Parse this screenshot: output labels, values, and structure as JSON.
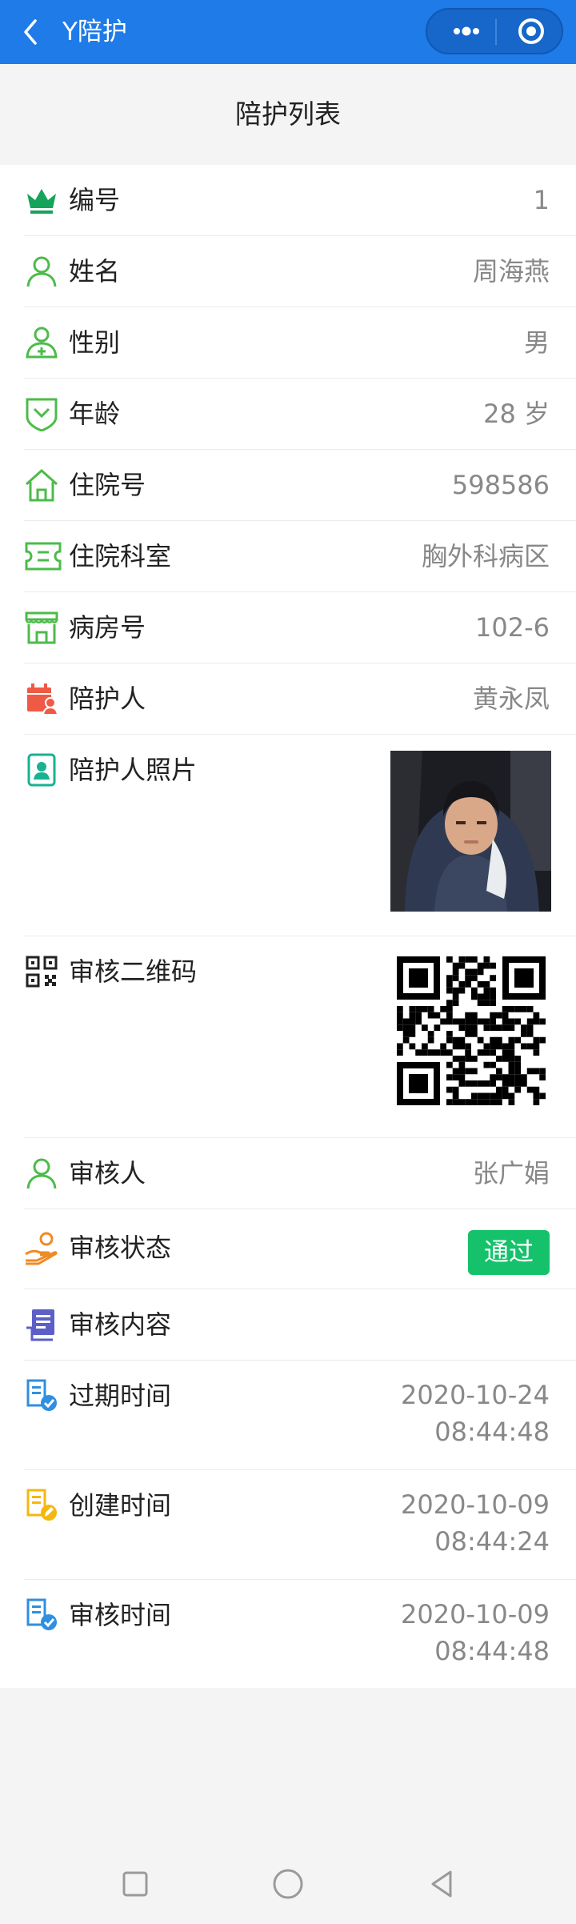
{
  "header": {
    "app_title": "Y陪护",
    "colors": {
      "bar": "#1e7be8",
      "capsule": "#1667c9"
    },
    "icons": [
      "back-arrow-icon",
      "more-dots-icon",
      "target-icon"
    ]
  },
  "page": {
    "title": "陪护列表"
  },
  "rows": {
    "number": {
      "label": "编号",
      "value": "1",
      "icon": "crown-icon"
    },
    "name": {
      "label": "姓名",
      "value": "周海燕",
      "icon": "person-icon"
    },
    "gender": {
      "label": "性别",
      "value": "男",
      "icon": "person-plus-icon"
    },
    "age": {
      "label": "年龄",
      "value": "28 岁",
      "icon": "shield-chevron-icon"
    },
    "admission_no": {
      "label": "住院号",
      "value": "598586",
      "icon": "home-icon"
    },
    "department": {
      "label": "住院科室",
      "value": "胸外科病区",
      "icon": "ticket-icon"
    },
    "room": {
      "label": "病房号",
      "value": "102-6",
      "icon": "store-icon"
    },
    "caregiver": {
      "label": "陪护人",
      "value": "黄永凤",
      "icon": "calendar-person-icon"
    },
    "caregiver_photo": {
      "label": "陪护人照片",
      "icon": "id-photo-icon"
    },
    "review_qr": {
      "label": "审核二维码",
      "icon": "qr-code-icon"
    },
    "reviewer": {
      "label": "审核人",
      "value": "张广娟",
      "icon": "person-icon"
    },
    "review_status": {
      "label": "审核状态",
      "value": "通过",
      "icon": "hand-coin-icon",
      "badge_color": "#15c26b"
    },
    "review_content": {
      "label": "审核内容",
      "icon": "document-icon"
    },
    "expire_time": {
      "label": "过期时间",
      "date": "2020-10-24",
      "time": "08:44:48",
      "icon": "doc-check-icon"
    },
    "create_time": {
      "label": "创建时间",
      "date": "2020-10-09",
      "time": "08:44:24",
      "icon": "doc-edit-icon"
    },
    "review_time": {
      "label": "审核时间",
      "date": "2020-10-09",
      "time": "08:44:48",
      "icon": "doc-check-icon"
    }
  },
  "system_nav": {
    "icons": [
      "square-icon",
      "circle-icon",
      "triangle-back-icon"
    ]
  }
}
